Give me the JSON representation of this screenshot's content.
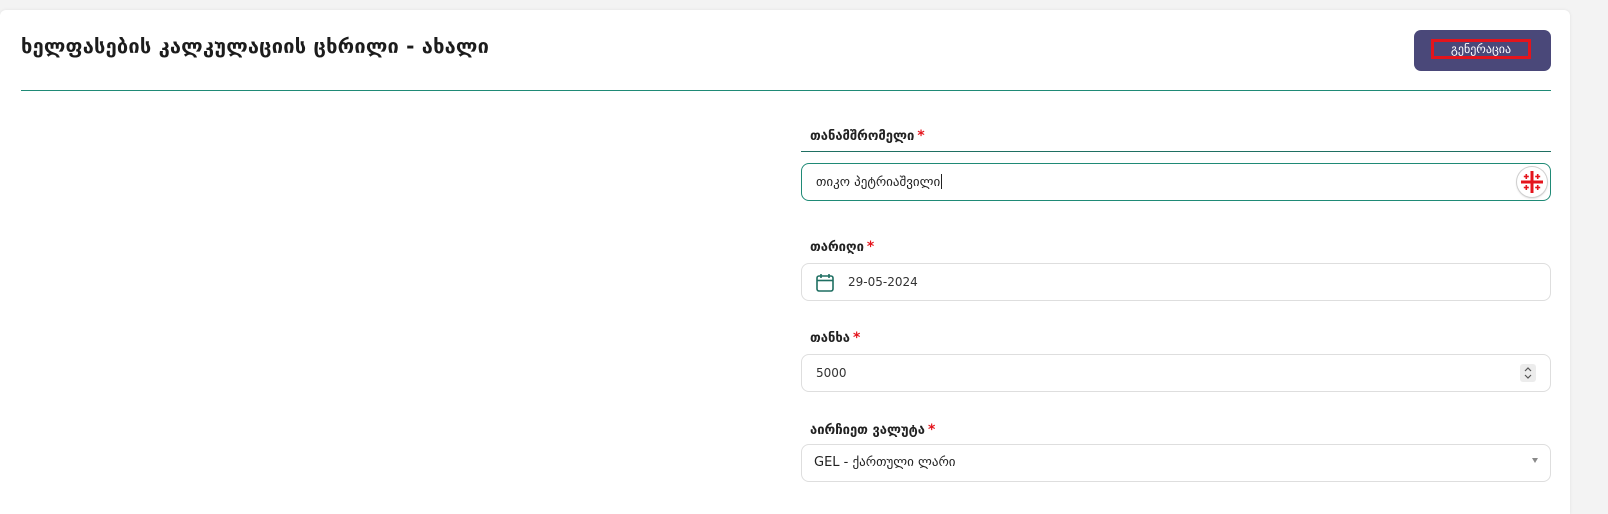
{
  "header": {
    "title": "ხელფასების კალკულაციის ცხრილი - ახალი",
    "generate_label": "გენერაცია"
  },
  "form": {
    "employee": {
      "label": "თანამშრომელი",
      "required_mark": "*",
      "value": "თიკო პეტრიაშვილი"
    },
    "date": {
      "label": "თარიღი",
      "required_mark": "*",
      "value": "29-05-2024"
    },
    "amount": {
      "label": "თანხა",
      "required_mark": "*",
      "value": "5000"
    },
    "currency": {
      "label": "აირჩიეთ ვალუტა",
      "required_mark": "*",
      "selected": "GEL - ქართული ლარი"
    }
  },
  "icons": {
    "keyboard": "georgian-keyboard-icon",
    "calendar": "calendar-icon",
    "stepper": "stepper-icon",
    "dropdown": "chevron-down-icon"
  },
  "colors": {
    "accent_teal": "#1f8a76",
    "button_bg": "#4a4879",
    "required_red": "#e4141c"
  }
}
